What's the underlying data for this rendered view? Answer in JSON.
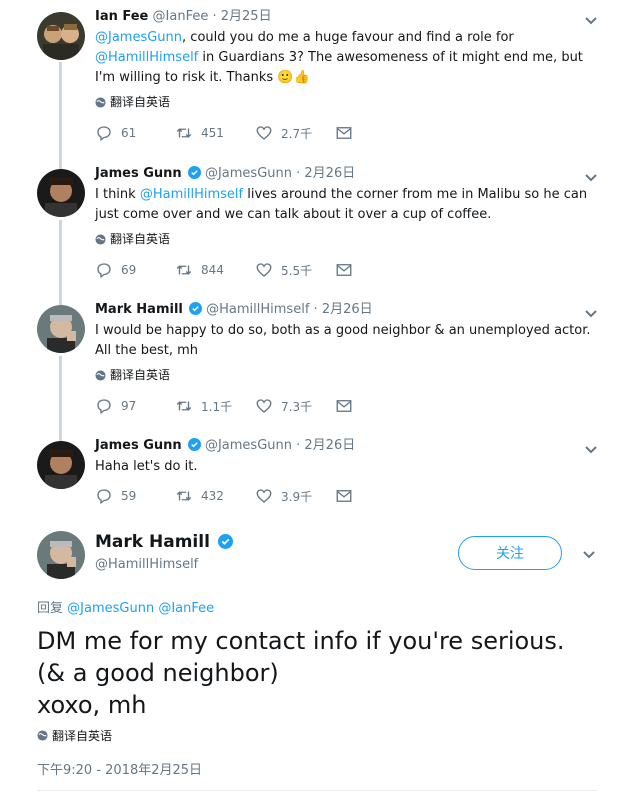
{
  "tweets": [
    {
      "name": "Ian Fee",
      "handle": "@IanFee",
      "sep": "·",
      "date": "2月25日",
      "text_parts": [
        "@JamesGunn",
        ", could you do me a huge favour and find a role for ",
        "@HamillHimself",
        " in Guardians 3? The awesomeness of it might end me, but I'm willing to risk it. Thanks ",
        "🙂👍"
      ],
      "translate": "翻译自英语",
      "replies": "61",
      "retweets": "451",
      "likes": "2.7千"
    },
    {
      "name": "James Gunn",
      "handle": "@JamesGunn",
      "sep": "·",
      "date": "2月26日",
      "text_parts": [
        "I think ",
        "@HamillHimself",
        " lives around the corner from me in Malibu so he can just come over and we can talk about it over a cup of coffee."
      ],
      "translate": "翻译自英语",
      "replies": "69",
      "retweets": "844",
      "likes": "5.5千"
    },
    {
      "name": "Mark Hamill",
      "handle": "@HamillHimself",
      "sep": "·",
      "date": "2月26日",
      "text_parts": [
        "I would be happy to do so, both as a good neighbor & an unemployed actor. All the best, mh"
      ],
      "translate": "翻译自英语",
      "replies": "97",
      "retweets": "1.1千",
      "likes": "7.3千"
    },
    {
      "name": "James Gunn",
      "handle": "@JamesGunn",
      "sep": "·",
      "date": "2月26日",
      "text_parts": [
        "Haha let's do it."
      ],
      "replies": "59",
      "retweets": "432",
      "likes": "3.9千"
    }
  ],
  "main_tweet": {
    "name": "Mark Hamill",
    "handle": "@HamillHimself",
    "follow_label": "关注",
    "reply_prefix": "回复",
    "reply_to_1": "@JamesGunn",
    "reply_to_2": "@IanFee",
    "text": "DM me for my contact info if you're serious.\n(& a good neighbor)\nxoxo, mh",
    "translate": "翻译自英语",
    "timestamp": "下午9:20 - 2018年2月25日"
  },
  "colors": {
    "link": "#1da1f2",
    "muted": "#657786",
    "thread_line": "#ccd6dd"
  },
  "icons": [
    "reply-icon",
    "retweet-icon",
    "like-icon",
    "message-icon",
    "chevron-down-icon",
    "verified-icon",
    "globe-icon"
  ]
}
